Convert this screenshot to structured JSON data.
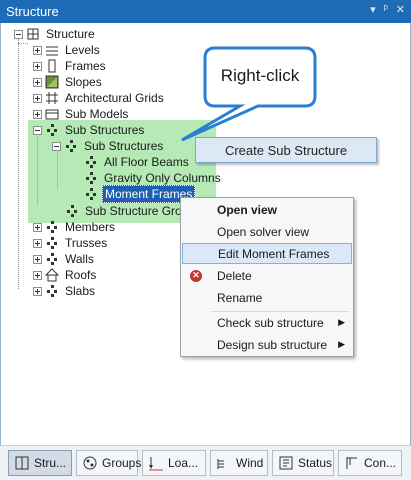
{
  "window": {
    "title": "Structure",
    "buttons": [
      "▾",
      "ᵖ",
      "✕"
    ]
  },
  "callout": {
    "text": "Right-click"
  },
  "tree": {
    "root": "Structure",
    "levels": "Levels",
    "frames": "Frames",
    "slopes": "Slopes",
    "architectural_grids": "Architectural Grids",
    "sub_models": "Sub Models",
    "sub_structures": "Sub Structures",
    "sub_structures_child": "Sub Structures",
    "all_floor_beams": "All Floor Beams",
    "gravity_only_columns": "Gravity Only Columns",
    "moment_frames": "Moment Frames",
    "sub_structure_groups": "Sub Structure Grou",
    "members": "Members",
    "trusses": "Trusses",
    "walls": "Walls",
    "roofs": "Roofs",
    "slabs": "Slabs"
  },
  "create_sub_structure": "Create Sub Structure",
  "context_menu": {
    "open_view": "Open view",
    "open_solver_view": "Open solver view",
    "edit_moment_frames": "Edit Moment Frames",
    "delete": "Delete",
    "rename": "Rename",
    "check_sub_structure": "Check sub structure",
    "design_sub_structure": "Design sub structure",
    "submenu_arrow": "▶"
  },
  "tabs": {
    "structure": "Stru...",
    "groups": "Groups",
    "loads": "Loa...",
    "wind": "Wind",
    "status": "Status",
    "con": "Con..."
  }
}
